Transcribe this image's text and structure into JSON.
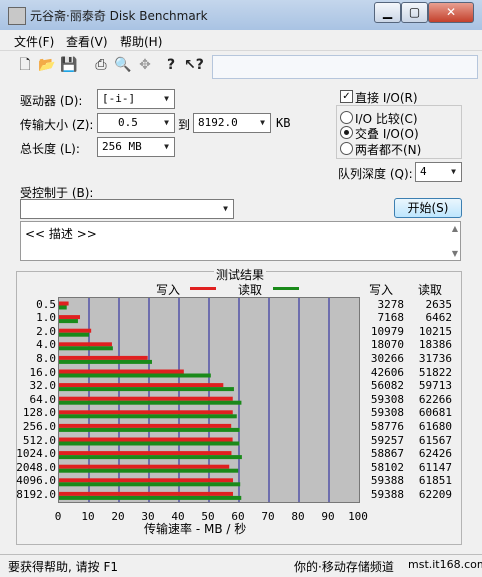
{
  "window": {
    "title": "元谷斋·丽泰奇 Disk Benchmark"
  },
  "menu": {
    "file": "文件(F)",
    "view": "查看(V)",
    "help": "帮助(H)"
  },
  "controls": {
    "drive_label": "驱动器 (D):",
    "drive_value": "[-i-]",
    "transfer_label": "传输大小 (Z):",
    "transfer_from": "0.5",
    "to_label": "到",
    "transfer_to": "8192.0",
    "kb_unit": "KB",
    "total_label": "总长度 (L):",
    "total_value": "256 MB",
    "direct_io_label": "直接 I/O(R)",
    "direct_io_checked": "✓",
    "io_compare_label": "I/O 比较(C)",
    "overlapped_label": "交叠 I/O(O)",
    "neither_label": "两者都不(N)",
    "queue_label": "队列深度 (Q):",
    "queue_value": "4",
    "controlled_label": "受控制于 (B):",
    "controlled_value": "",
    "start_label": "开始(S)",
    "description": "<< 描述 >>"
  },
  "results": {
    "title": "测试结果",
    "legend_write": "写入",
    "legend_read": "读取",
    "col_write": "写入",
    "col_read": "读取",
    "xlabel": "传输速率 - MB / 秒"
  },
  "status": {
    "help_text": "要获得帮助, 请按 F1",
    "watermark": "你的·移动存储频道",
    "site": "mst.it168.com"
  },
  "colors": {
    "write": "#e02020",
    "read": "#1a8a1a",
    "grid": "#1c1c9c",
    "plot_bg": "#c0c0c0"
  },
  "icons": [
    "new-file-icon",
    "open-folder-icon",
    "save-icon",
    "print-icon",
    "print-preview-icon",
    "move-icon",
    "help-icon",
    "context-help-icon"
  ],
  "chart_data": {
    "type": "bar",
    "orientation": "horizontal",
    "categories": [
      "0.5",
      "1.0",
      "2.0",
      "4.0",
      "8.0",
      "16.0",
      "32.0",
      "64.0",
      "128.0",
      "256.0",
      "512.0",
      "1024.0",
      "2048.0",
      "4096.0",
      "8192.0"
    ],
    "series": [
      {
        "name": "写入",
        "values": [
          3278,
          7168,
          10979,
          18070,
          30266,
          42606,
          56082,
          59308,
          59308,
          58776,
          59257,
          58867,
          58102,
          59388,
          59388
        ]
      },
      {
        "name": "读取",
        "values": [
          2635,
          6462,
          10215,
          18386,
          31736,
          51822,
          59713,
          62266,
          60681,
          61680,
          61567,
          62426,
          61147,
          61851,
          62209
        ]
      }
    ],
    "xlabel": "传输速率 - MB / 秒",
    "xlim": [
      0,
      100
    ],
    "xticks": [
      "0",
      "10",
      "20",
      "30",
      "40",
      "50",
      "60",
      "70",
      "80",
      "90",
      "100"
    ],
    "unit_scale": "values in KB/s; bars scaled to MB/s",
    "grid": true,
    "legend": "top"
  }
}
